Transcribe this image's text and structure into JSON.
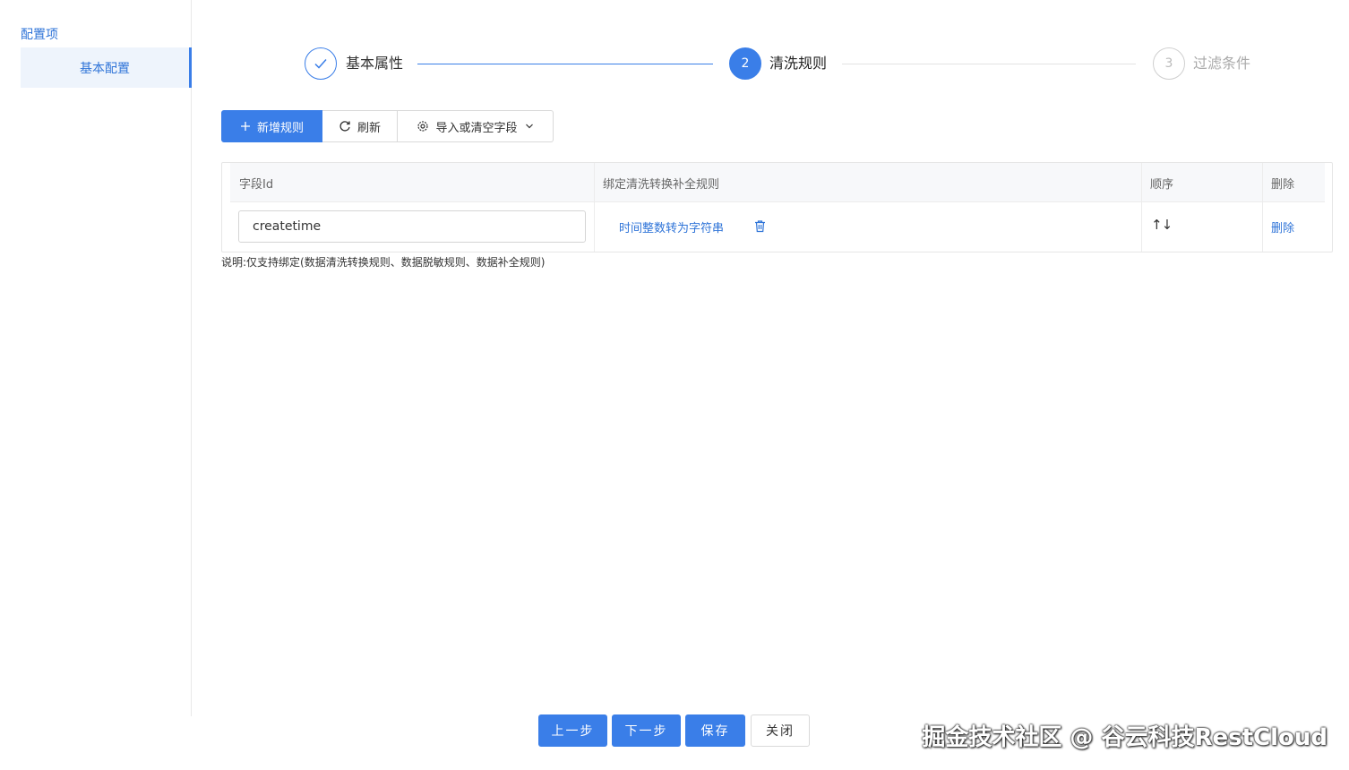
{
  "sidebar": {
    "title": "配置项",
    "items": [
      {
        "label": "基本配置"
      }
    ]
  },
  "steps": [
    {
      "number": "1",
      "label": "基本属性",
      "state": "done"
    },
    {
      "number": "2",
      "label": "清洗规则",
      "state": "active"
    },
    {
      "number": "3",
      "label": "过滤条件",
      "state": "pending"
    }
  ],
  "toolbar": {
    "add_label": "新增规则",
    "refresh_label": "刷新",
    "import_label": "导入或清空字段"
  },
  "table": {
    "headers": [
      "字段Id",
      "绑定清洗转换补全规则",
      "顺序",
      "删除"
    ],
    "rows": [
      {
        "field_id": "createtime",
        "rule": "时间整数转为字符串",
        "order": "↑↓",
        "delete": "删除"
      }
    ]
  },
  "note": "说明:仅支持绑定(数据清洗转换规则、数据脱敏规则、数据补全规则)",
  "footer": {
    "prev": "上一步",
    "next": "下一步",
    "save": "保存",
    "close": "关闭"
  },
  "watermark": "掘金技术社区 @ 谷云科技RestCloud",
  "colors": {
    "primary": "#3a7ee8",
    "link": "#2f74d8"
  }
}
